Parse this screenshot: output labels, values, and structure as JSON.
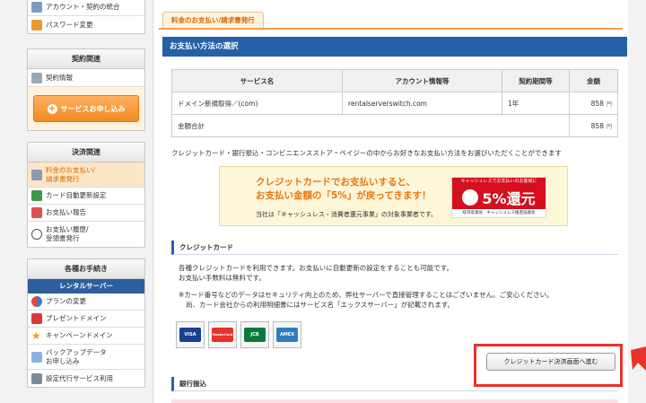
{
  "sidebar": {
    "account_box": {
      "items": [
        {
          "label": "アカウント・契約の統合",
          "icon": "link-icon"
        },
        {
          "label": "パスワード変更",
          "icon": "lock-icon"
        }
      ]
    },
    "contract_box": {
      "heading": "契約関連",
      "items": [
        {
          "label": "契約情報",
          "icon": "clipboard-icon"
        }
      ],
      "apply_button": "サービスお申し込み"
    },
    "payment_box": {
      "heading": "決済関連",
      "items": [
        {
          "label": "料金のお支払い/\n請求書発行",
          "icon": "invoice-icon"
        },
        {
          "label": "カード自動更新設定",
          "icon": "card-icon"
        },
        {
          "label": "お支払い報告",
          "icon": "report-icon"
        },
        {
          "label": "お支払い履歴/\n受領書発行",
          "icon": "clock-icon"
        }
      ]
    },
    "procedures_box": {
      "heading": "各種お手続き",
      "subheading": "レンタルサーバー",
      "items": [
        {
          "label": "プランの変更",
          "icon": "arrows-icon"
        },
        {
          "label": "プレゼントドメイン",
          "icon": "gift-icon"
        },
        {
          "label": "キャンペーンドメイン",
          "icon": "star-icon"
        },
        {
          "label": "バックアップデータ\nお申し込み",
          "icon": "backup-icon"
        },
        {
          "label": "設定代行サービス利用",
          "icon": "wrench-icon"
        }
      ]
    }
  },
  "main": {
    "tab_label": "料金のお支払い/請求書発行",
    "section_title": "お支払い方法の選択",
    "table": {
      "headers": [
        "サービス名",
        "アカウント情報等",
        "契約期間等",
        "金額"
      ],
      "rows": [
        {
          "service": "ドメイン新規取得／(com)",
          "account": "rentalserverswitch.com",
          "period": "1年",
          "amount": "858",
          "unit": "円"
        }
      ],
      "total_label": "金額合計",
      "total_amount": "858",
      "total_unit": "円"
    },
    "method_note": "クレジットカード・銀行振込・コンビニエンスストア・ペイジーの中からお好きなお支払い方法をお選びいただくことができます",
    "banner": {
      "line1": "クレジットカードでお支払いすると、",
      "line2": "お支払い金額の「5%」が戻ってきます！",
      "sub": "当社は「キャッシュレス・消費者還元事業」の対象事業者です。",
      "badge_top": "キャッシュレスでお支払いのお客様に",
      "badge_main": "5%還元",
      "badge_bottom": "経済産業省　キャッシュレス推進協議会"
    },
    "credit": {
      "heading": "クレジットカード",
      "text1": "各種クレジットカードを利用できます。お支払いに自動更新の設定をすることも可能です。",
      "text2": "お支払い手数料は無料です。",
      "text3": "※カード番号などのデータはセキュリティ向上のため、弊社サーバーで直接管理することはございません。ご安心ください。",
      "text4": "尚、カード会社からの利用明細書にはサービス名「エックスサーバー」が記載されます。",
      "cards": [
        {
          "label": "VISA",
          "color": "#1a3f8f"
        },
        {
          "label": "MasterCard",
          "color": "#e8322a"
        },
        {
          "label": "JCB",
          "color": "#0a7a3a"
        },
        {
          "label": "AMEX",
          "color": "#2f7dbf"
        }
      ],
      "button": "クレジットカード決済画面へ進む"
    },
    "bank": {
      "heading": "銀行振込"
    }
  },
  "colors": {
    "accent_blue": "#2561a9",
    "highlight_red": "#e8322a",
    "orange": "#f08a20"
  }
}
